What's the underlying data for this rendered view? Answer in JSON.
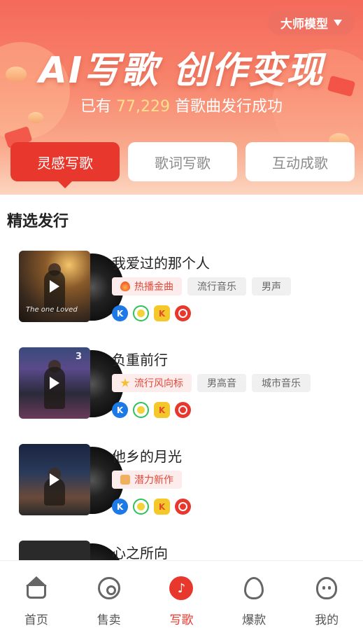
{
  "header": {
    "model_selector": "大师模型",
    "title": "AI写歌 创作变现",
    "subtitle_prefix": "已有",
    "subtitle_count": "77,229",
    "subtitle_suffix": "首歌曲发行成功"
  },
  "mode_tabs": [
    {
      "label": "灵感写歌",
      "active": true
    },
    {
      "label": "歌词写歌",
      "active": false
    },
    {
      "label": "互动成歌",
      "active": false
    }
  ],
  "section": {
    "title": "精选发行"
  },
  "songs": [
    {
      "title": "我爱过的那个人",
      "cover_caption": "The one Loved",
      "tags": [
        {
          "label": "热播金曲",
          "type": "hot",
          "icon": "fire-icon"
        },
        {
          "label": "流行音乐",
          "type": "normal"
        },
        {
          "label": "男声",
          "type": "normal"
        }
      ],
      "platforms": [
        "kugou-icon",
        "qq-music-icon",
        "kuwo-icon",
        "netease-icon"
      ]
    },
    {
      "title": "负重前行",
      "cover_caption": "3",
      "tags": [
        {
          "label": "流行风向标",
          "type": "hot",
          "icon": "star-icon"
        },
        {
          "label": "男高音",
          "type": "normal"
        },
        {
          "label": "城市音乐",
          "type": "normal"
        }
      ],
      "platforms": [
        "kugou-icon",
        "qq-music-icon",
        "kuwo-icon",
        "netease-icon"
      ]
    },
    {
      "title": "他乡的月光",
      "cover_caption": "",
      "tags": [
        {
          "label": "潜力新作",
          "type": "hot",
          "icon": "thumbs-up-icon"
        }
      ],
      "platforms": [
        "kugou-icon",
        "qq-music-icon",
        "kuwo-icon",
        "netease-icon"
      ]
    },
    {
      "title": "心之所向",
      "cover_caption": "",
      "tags": [],
      "platforms": []
    }
  ],
  "tabbar": [
    {
      "label": "首页",
      "icon": "home-icon",
      "active": false
    },
    {
      "label": "售卖",
      "icon": "disc-icon",
      "active": false
    },
    {
      "label": "写歌",
      "icon": "music-note-icon",
      "active": true
    },
    {
      "label": "爆款",
      "icon": "flame-icon",
      "active": false
    },
    {
      "label": "我的",
      "icon": "profile-icon",
      "active": false
    }
  ],
  "colors": {
    "accent": "#e8372c",
    "highlight_number": "#ffe08a"
  }
}
